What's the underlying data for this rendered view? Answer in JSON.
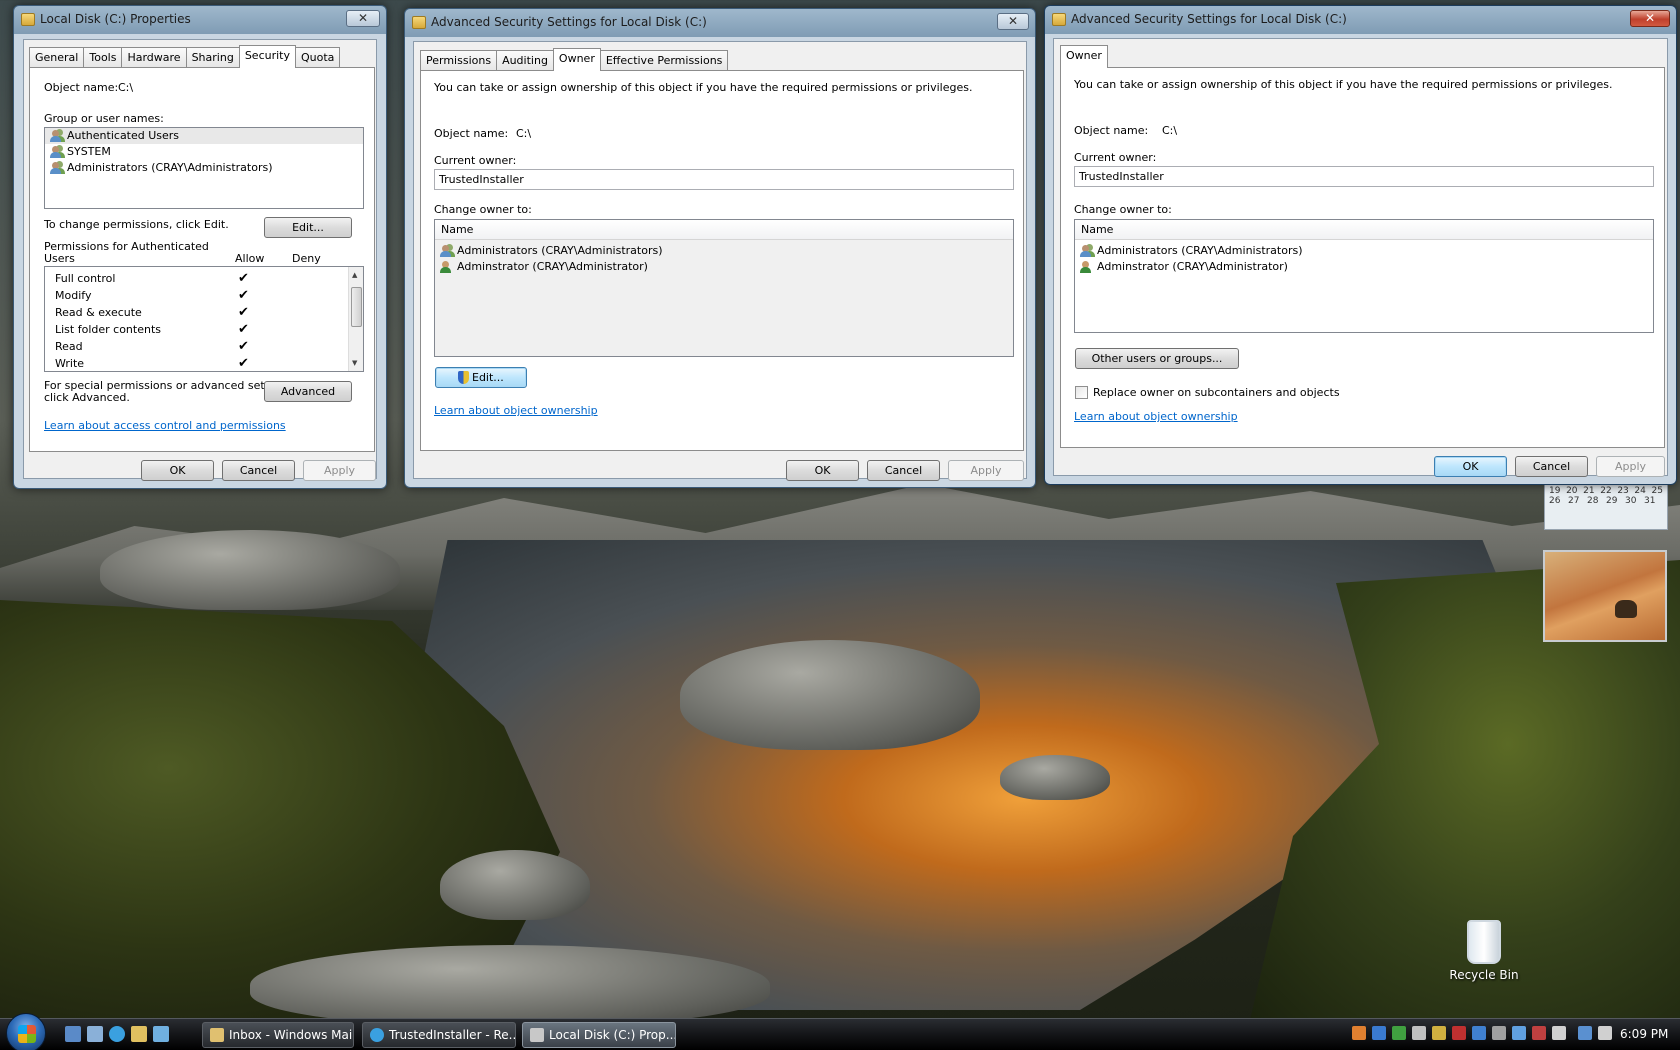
{
  "win1": {
    "title": "Local Disk (C:) Properties",
    "tabs": [
      "General",
      "Tools",
      "Hardware",
      "Sharing",
      "Security",
      "Quota"
    ],
    "object_label": "Object name:",
    "object_value": "C:\\",
    "group_label": "Group or user names:",
    "users": [
      "Authenticated Users",
      "SYSTEM",
      "Administrators (CRAY\\Administrators)"
    ],
    "change_text": "To change permissions, click Edit.",
    "edit_label": "Edit...",
    "perms_header_a": "Permissions for Authenticated",
    "perms_header_b": "Users",
    "allow_label": "Allow",
    "deny_label": "Deny",
    "permissions": [
      "Full control",
      "Modify",
      "Read & execute",
      "List folder contents",
      "Read",
      "Write"
    ],
    "special_text_a": "For special permissions or advanced settings,",
    "special_text_b": "click Advanced.",
    "advanced_label": "Advanced",
    "learn_link": "Learn about access control and permissions",
    "ok": "OK",
    "cancel": "Cancel",
    "apply": "Apply"
  },
  "win2": {
    "title": "Advanced Security Settings for Local Disk (C:)",
    "tabs": [
      "Permissions",
      "Auditing",
      "Owner",
      "Effective Permissions"
    ],
    "intro": "You can take or assign ownership of this object if you have the required permissions or privileges.",
    "object_label": "Object name:",
    "object_value": "C:\\",
    "current_owner_label": "Current owner:",
    "current_owner_value": "TrustedInstaller",
    "change_owner_label": "Change owner to:",
    "name_col": "Name",
    "owners": [
      "Administrators (CRAY\\Administrators)",
      "Adminstrator (CRAY\\Administrator)"
    ],
    "edit_label": "Edit...",
    "learn_link": "Learn about object ownership",
    "ok": "OK",
    "cancel": "Cancel",
    "apply": "Apply"
  },
  "win3": {
    "title": "Advanced Security Settings for Local Disk (C:)",
    "tabs": [
      "Owner"
    ],
    "intro": "You can take or assign ownership of this object if you have the required permissions or privileges.",
    "object_label": "Object name:",
    "object_value": "C:\\",
    "current_owner_label": "Current owner:",
    "current_owner_value": "TrustedInstaller",
    "change_owner_label": "Change owner to:",
    "name_col": "Name",
    "owners": [
      "Administrators (CRAY\\Administrators)",
      "Adminstrator (CRAY\\Administrator)"
    ],
    "other_users_label": "Other users or groups...",
    "replace_label": "Replace owner on subcontainers and objects",
    "learn_link": "Learn about object ownership",
    "ok": "OK",
    "cancel": "Cancel",
    "apply": "Apply"
  },
  "desktop": {
    "recycle_bin": "Recycle Bin",
    "calendar_rows": [
      [
        "19",
        "20",
        "21",
        "22",
        "23",
        "24",
        "25"
      ],
      [
        "26",
        "27",
        "28",
        "29",
        "30",
        "31",
        ""
      ]
    ]
  },
  "taskbar": {
    "buttons": [
      "Inbox - Windows Mail",
      "TrustedInstaller - Re...",
      "Local Disk (C:) Prop..."
    ],
    "clock": "6:09 PM"
  }
}
